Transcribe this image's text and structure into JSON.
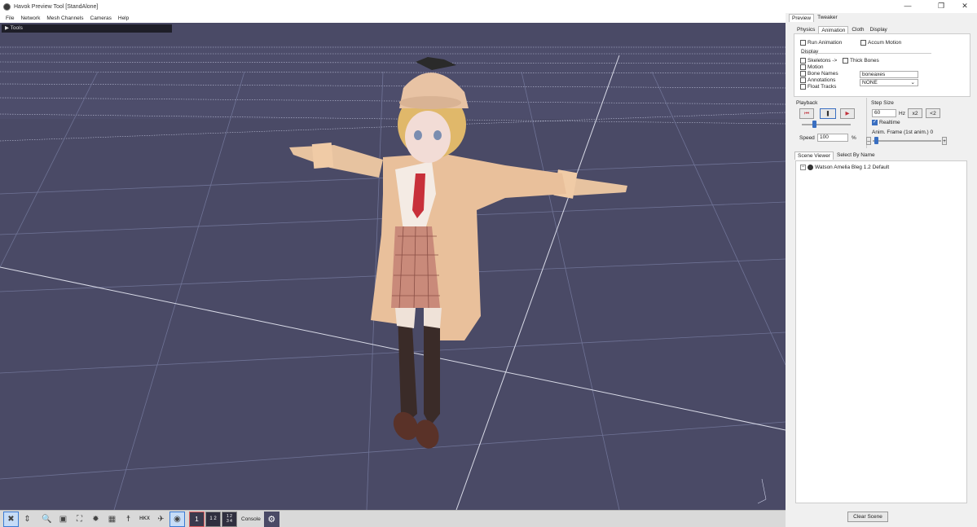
{
  "window": {
    "title": "Havok Preview Tool [StandAlone]",
    "min_glyph": "—",
    "restore_glyph": "❐",
    "close_glyph": "✕"
  },
  "menu": {
    "items": [
      "File",
      "Network",
      "Mesh Channels",
      "Cameras",
      "Help"
    ]
  },
  "viewport": {
    "tools_label": "▶  Tools",
    "background": "#4a4a66"
  },
  "toolbar": {
    "console_label": "Console",
    "hkx_label": "HKX",
    "num1": "1",
    "num2": "1 2",
    "num4": "1 2\n3 4"
  },
  "right_panel": {
    "top_tabs": [
      "Preview",
      "Tweaker"
    ],
    "sub_tabs": [
      "Physics",
      "Animation",
      "Cloth",
      "Display"
    ],
    "run_animation": "Run Animation",
    "accum_motion": "Accum Motion",
    "display_label": "Display",
    "display_items": [
      "Skeletons ->",
      "Motion",
      "Bone Names",
      "Annotations",
      "Float Tracks"
    ],
    "thick_bones": "Thick Bones",
    "bone_field_placeholder": "boneaxes",
    "none_select": "NONE",
    "playback_label": "Playback",
    "step_size_label": "Step Size",
    "step_value": "60",
    "hz_label": "Hz",
    "x2_label": "x2",
    "half_label": "<2",
    "realtime_label": "Realtime",
    "speed_label": "Speed",
    "speed_value": "100",
    "percent": "%",
    "anim_frame_label": "Anim. Frame (1st anim.) 0",
    "scene_viewer_tabs": [
      "Scene Viewer",
      "Select By Name"
    ],
    "scene_root": "Watson Amelia Bleg 1.2 Default",
    "clear_scene": "Clear Scene"
  }
}
